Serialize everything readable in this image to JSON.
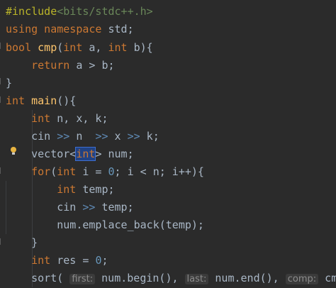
{
  "editor": {
    "lines": [
      {
        "parts": [
          {
            "t": "#include",
            "c": "pp"
          },
          {
            "t": "<bits/stdc++.h>",
            "c": "inc"
          }
        ]
      },
      {
        "parts": [
          {
            "t": "using namespace ",
            "c": "kw"
          },
          {
            "t": "std;",
            "c": ""
          }
        ]
      },
      {
        "parts": [
          {
            "t": "bool ",
            "c": "kw"
          },
          {
            "t": "cmp",
            "c": "fn"
          },
          {
            "t": "(",
            "c": ""
          },
          {
            "t": "int ",
            "c": "kw"
          },
          {
            "t": "a, ",
            "c": ""
          },
          {
            "t": "int ",
            "c": "kw"
          },
          {
            "t": "b){",
            "c": ""
          }
        ]
      },
      {
        "parts": [
          {
            "t": "    ",
            "c": ""
          },
          {
            "t": "return ",
            "c": "kw"
          },
          {
            "t": "a > b;",
            "c": ""
          }
        ]
      },
      {
        "parts": [
          {
            "t": "}",
            "c": ""
          }
        ]
      },
      {
        "parts": [
          {
            "t": "int ",
            "c": "kw"
          },
          {
            "t": "main",
            "c": "fn"
          },
          {
            "t": "(){",
            "c": ""
          }
        ]
      },
      {
        "parts": [
          {
            "t": "    ",
            "c": ""
          },
          {
            "t": "int ",
            "c": "kw"
          },
          {
            "t": "n, x, k;",
            "c": ""
          }
        ]
      },
      {
        "parts": [
          {
            "t": "    cin ",
            "c": ""
          },
          {
            "t": ">>",
            "c": "op"
          },
          {
            "t": " n  ",
            "c": ""
          },
          {
            "t": ">>",
            "c": "op"
          },
          {
            "t": " x ",
            "c": ""
          },
          {
            "t": ">>",
            "c": "op"
          },
          {
            "t": " k;",
            "c": ""
          }
        ]
      },
      {
        "parts": [
          {
            "t": "    vector<",
            "c": ""
          },
          {
            "t": "int",
            "c": "kw sel"
          },
          {
            "t": "> num;",
            "c": ""
          }
        ]
      },
      {
        "parts": [
          {
            "t": "    ",
            "c": ""
          },
          {
            "t": "for",
            "c": "kw"
          },
          {
            "t": "(",
            "c": ""
          },
          {
            "t": "int ",
            "c": "kw"
          },
          {
            "t": "i = ",
            "c": ""
          },
          {
            "t": "0",
            "c": "num"
          },
          {
            "t": "; i < n; i++){",
            "c": ""
          }
        ]
      },
      {
        "parts": [
          {
            "t": "        ",
            "c": ""
          },
          {
            "t": "int ",
            "c": "kw"
          },
          {
            "t": "temp;",
            "c": ""
          }
        ]
      },
      {
        "parts": [
          {
            "t": "        cin ",
            "c": ""
          },
          {
            "t": ">>",
            "c": "op"
          },
          {
            "t": " temp;",
            "c": ""
          }
        ]
      },
      {
        "parts": [
          {
            "t": "        num.emplace_back(temp);",
            "c": ""
          }
        ]
      },
      {
        "parts": [
          {
            "t": "    }",
            "c": ""
          }
        ]
      },
      {
        "parts": [
          {
            "t": "    ",
            "c": ""
          },
          {
            "t": "int ",
            "c": "kw"
          },
          {
            "t": "res = ",
            "c": ""
          },
          {
            "t": "0",
            "c": "num"
          },
          {
            "t": ";",
            "c": ""
          }
        ]
      },
      {
        "parts": [
          {
            "t": "    sort( ",
            "c": ""
          },
          {
            "t": "first:",
            "c": "hint"
          },
          {
            "t": " num.begin(), ",
            "c": ""
          },
          {
            "t": "last:",
            "c": "hint"
          },
          {
            "t": " num.end(), ",
            "c": ""
          },
          {
            "t": "comp:",
            "c": "hint"
          },
          {
            "t": " cmp);",
            "c": ""
          }
        ]
      }
    ]
  },
  "gutter": {
    "bulb_icon": "lightbulb-icon",
    "bulb_color": "#e8b441"
  }
}
